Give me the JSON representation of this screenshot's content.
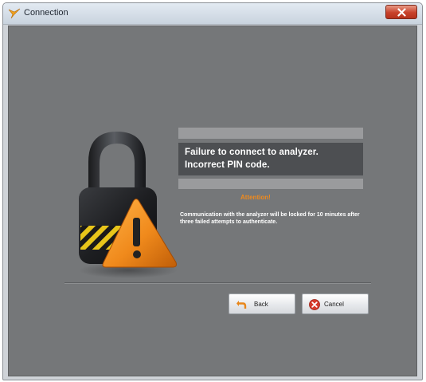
{
  "window": {
    "title": "Connection"
  },
  "dialog": {
    "message_line1": "Failure to connect to analyzer.",
    "message_line2": "Incorrect PIN code.",
    "attention_label": "Attention!",
    "note": "Communication with the analyzer will be locked for 10 minutes after three failed attempts to authenticate."
  },
  "buttons": {
    "back_label": "Back",
    "cancel_label": "Cancel"
  },
  "colors": {
    "accent_orange": "#f08a1c",
    "panel_gray": "#757779",
    "message_bg": "#4d4f52"
  },
  "icons": {
    "title": "app-logo-icon",
    "close": "close-icon",
    "illustration": "padlock-warning-icon",
    "back": "back-arrow-icon",
    "cancel": "cancel-icon"
  }
}
